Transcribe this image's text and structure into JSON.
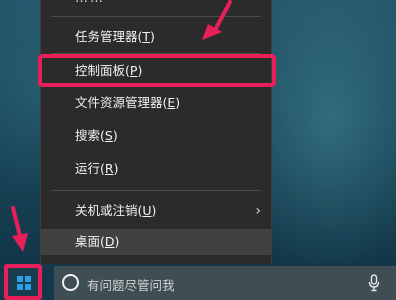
{
  "menu": {
    "top_partial": "……",
    "items": [
      {
        "label": "任务管理器(",
        "key": "T",
        "suffix": ")"
      },
      {
        "label": "控制面板(",
        "key": "P",
        "suffix": ")"
      },
      {
        "label": "文件资源管理器(",
        "key": "E",
        "suffix": ")"
      },
      {
        "label": "搜索(",
        "key": "S",
        "suffix": ")"
      },
      {
        "label": "运行(",
        "key": "R",
        "suffix": ")"
      },
      {
        "label": "关机或注销(",
        "key": "U",
        "suffix": ")"
      },
      {
        "label": "桌面(",
        "key": "D",
        "suffix": ")"
      }
    ],
    "submenu_arrow": "›"
  },
  "taskbar": {
    "search_placeholder": "有问题尽管问我"
  },
  "annotation_colors": {
    "highlight": "#e8205a"
  },
  "icons": {
    "start": "windows-logo-icon",
    "cortana": "cortana-circle-icon",
    "mic": "microphone-icon",
    "submenu": "chevron-right-icon",
    "annotation_arrow": "arrow-pointer-icon"
  }
}
